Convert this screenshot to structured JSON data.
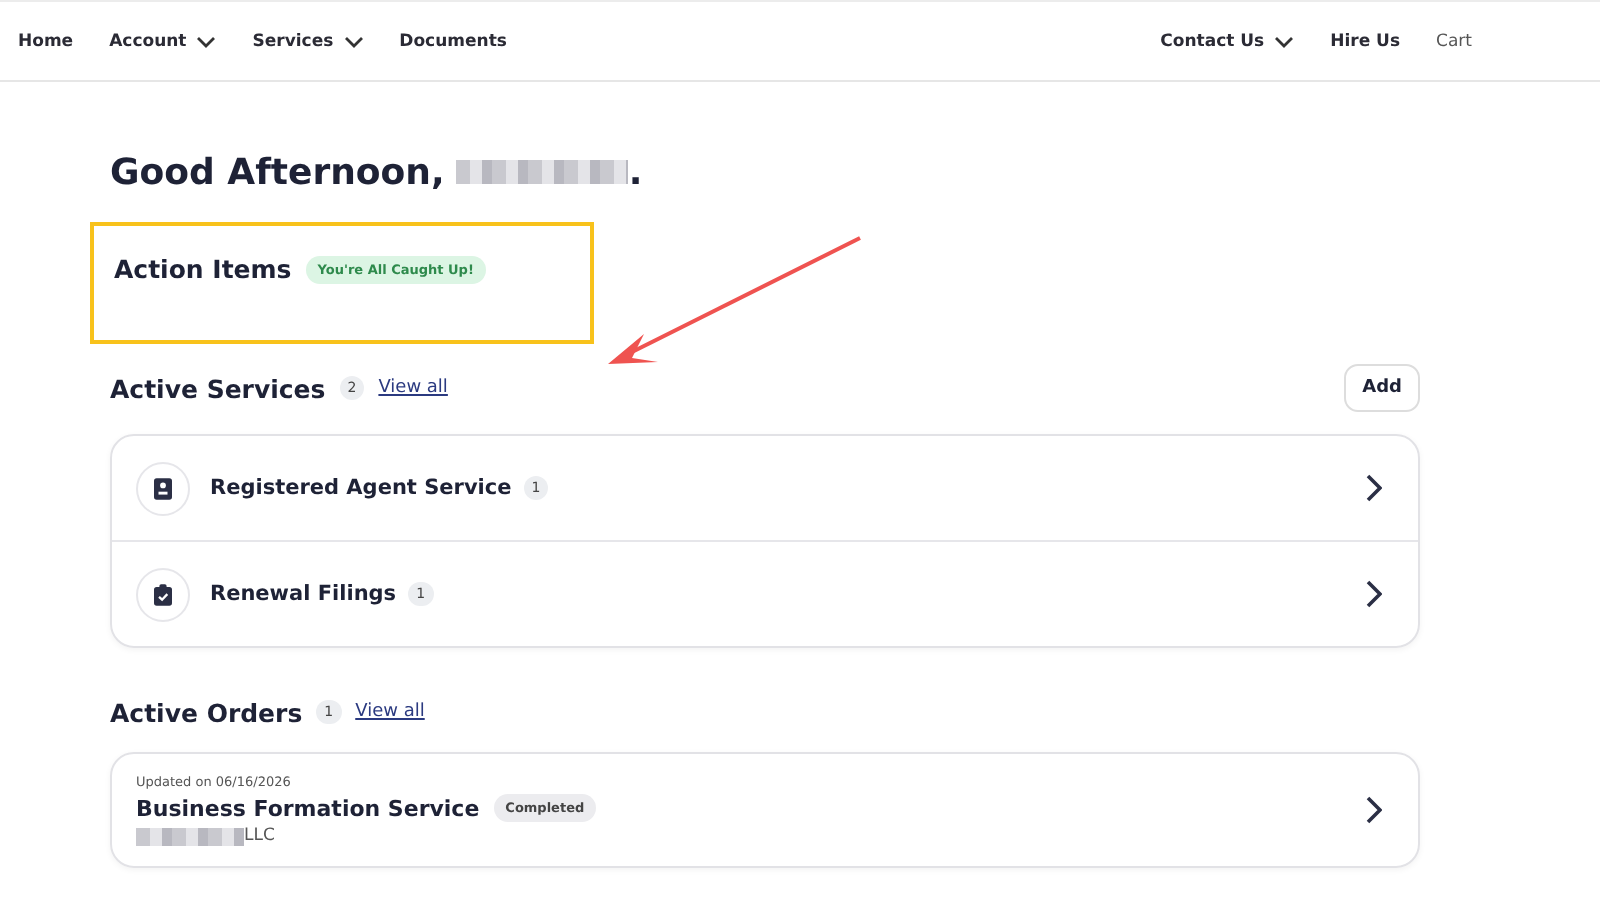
{
  "nav": {
    "left": [
      {
        "label": "Home",
        "dropdown": false
      },
      {
        "label": "Account",
        "dropdown": true
      },
      {
        "label": "Services",
        "dropdown": true
      },
      {
        "label": "Documents",
        "dropdown": false
      }
    ],
    "right": [
      {
        "label": "Contact Us",
        "dropdown": true
      },
      {
        "label": "Hire Us",
        "dropdown": false
      },
      {
        "label": "Cart",
        "dropdown": false
      }
    ]
  },
  "greeting": {
    "text": "Good Afternoon,",
    "end": "."
  },
  "action_items": {
    "title": "Action Items",
    "badge": "You're All Caught Up!",
    "highlighted": true
  },
  "active_services": {
    "title": "Active Services",
    "count": "2",
    "link": "View all",
    "button": "Add",
    "items": [
      {
        "kind": "agent",
        "name": "Registered Agent Service",
        "count": "1"
      },
      {
        "kind": "filings",
        "name": "Renewal Filings",
        "count": "1"
      }
    ]
  },
  "active_orders": {
    "title": "Active Orders",
    "count": "1",
    "link": "View all",
    "items": [
      {
        "updated": "Updated on 06/16/2026",
        "name": "Business Formation Service",
        "status": "Completed",
        "company": "LLC"
      }
    ]
  }
}
